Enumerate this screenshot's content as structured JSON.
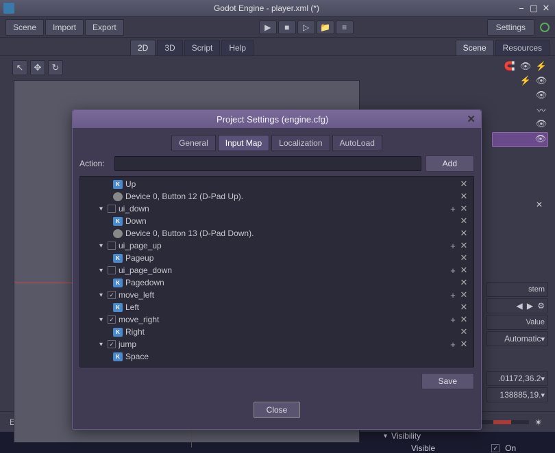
{
  "window": {
    "title": "Godot Engine - player.xml (*)"
  },
  "menu": {
    "scene": "Scene",
    "import": "Import",
    "export": "Export"
  },
  "settings_button": "Settings",
  "editor_tabs": {
    "d2": "2D",
    "d3": "3D",
    "script": "Script",
    "help": "Help"
  },
  "right_tabs": {
    "scene": "Scene",
    "resources": "Resources"
  },
  "dialog": {
    "title": "Project Settings (engine.cfg)",
    "tabs": {
      "general": "General",
      "input_map": "Input Map",
      "localization": "Localization",
      "autoload": "AutoLoad"
    },
    "action_label": "Action:",
    "add_button": "Add",
    "save_button": "Save",
    "close_button": "Close",
    "tree": {
      "items": [
        {
          "type": "key",
          "label": "Up",
          "indent": 2,
          "plus": false,
          "x": true
        },
        {
          "type": "joy",
          "label": "Device 0, Button 12 (D-Pad Up).",
          "indent": 2,
          "plus": false,
          "x": true
        },
        {
          "type": "action",
          "label": "ui_down",
          "indent": 1,
          "checked": false,
          "plus": true,
          "x": true
        },
        {
          "type": "key",
          "label": "Down",
          "indent": 2,
          "plus": false,
          "x": true
        },
        {
          "type": "joy",
          "label": "Device 0, Button 13 (D-Pad Down).",
          "indent": 2,
          "plus": false,
          "x": true
        },
        {
          "type": "action",
          "label": "ui_page_up",
          "indent": 1,
          "checked": false,
          "plus": true,
          "x": true
        },
        {
          "type": "key",
          "label": "Pageup",
          "indent": 2,
          "plus": false,
          "x": true
        },
        {
          "type": "action",
          "label": "ui_page_down",
          "indent": 1,
          "checked": false,
          "plus": true,
          "x": true
        },
        {
          "type": "key",
          "label": "Pagedown",
          "indent": 2,
          "plus": false,
          "x": true
        },
        {
          "type": "action",
          "label": "move_left",
          "indent": 1,
          "checked": true,
          "plus": true,
          "x": true
        },
        {
          "type": "key",
          "label": "Left",
          "indent": 2,
          "plus": false,
          "x": true
        },
        {
          "type": "action",
          "label": "move_right",
          "indent": 1,
          "checked": true,
          "plus": true,
          "x": true
        },
        {
          "type": "key",
          "label": "Right",
          "indent": 2,
          "plus": false,
          "x": true
        },
        {
          "type": "action",
          "label": "jump",
          "indent": 1,
          "checked": true,
          "plus": true,
          "x": true
        },
        {
          "type": "key",
          "label": "Space",
          "indent": 2,
          "plus": false,
          "x": false
        }
      ]
    }
  },
  "right_props": {
    "stem": "stem",
    "value": "Value",
    "automatic": "Automatic",
    "coord1": ".01172,36.2",
    "coord2": "138885,19."
  },
  "visibility": {
    "label": "Visibility",
    "visible": "Visible",
    "on": "On"
  },
  "status": {
    "text": "Edit CanvasItem"
  }
}
